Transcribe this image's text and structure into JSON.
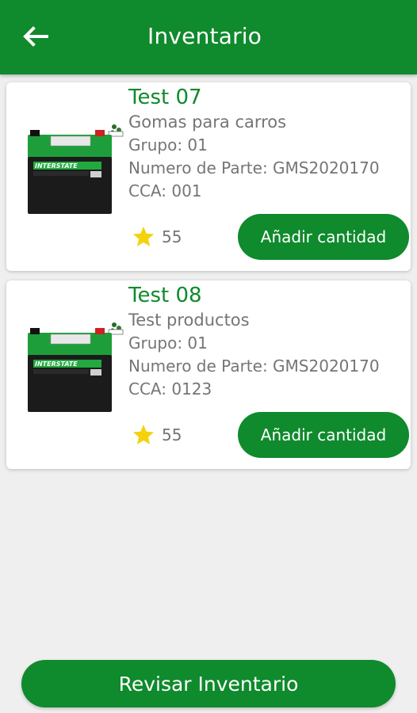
{
  "appbar": {
    "title": "Inventario",
    "back_icon": "arrow-left-icon",
    "color": "#0f8a2c"
  },
  "products": [
    {
      "title": "Test 07",
      "description": "Gomas para carros",
      "grupo": "Grupo: 01",
      "numero_parte": "Numero de Parte: GMS2020170",
      "cca": "CCA: 001",
      "rating": "55",
      "add_label": "Añadir cantidad",
      "image_brand": "INTERSTATE"
    },
    {
      "title": "Test 08",
      "description": "Test productos",
      "grupo": "Grupo: 01",
      "numero_parte": "Numero de Parte: GMS2020170",
      "cca": "CCA: 0123",
      "rating": "55",
      "add_label": "Añadir cantidad",
      "image_brand": "INTERSTATE"
    }
  ],
  "review_button": {
    "label": "Revisar Inventario"
  },
  "colors": {
    "accent": "#0f8a2c",
    "star": "#f4d20c",
    "text_secondary": "#757575"
  }
}
